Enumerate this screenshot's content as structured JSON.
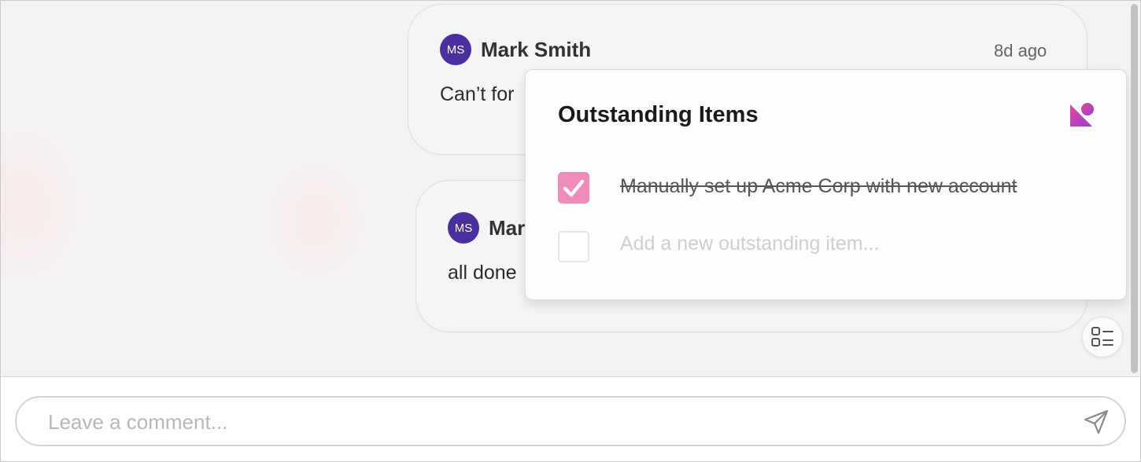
{
  "comments": [
    {
      "initials": "MS",
      "author": "Mark Smith",
      "time": "8d ago",
      "text": "Can’t for"
    },
    {
      "initials": "MS",
      "author": "Mar",
      "text": "all done"
    }
  ],
  "outstanding": {
    "title": "Outstanding Items",
    "items": [
      {
        "label": "Manually set up Acme Corp with new account",
        "checked": true
      }
    ],
    "new_item_placeholder": "Add a new outstanding item..."
  },
  "composer": {
    "placeholder": "Leave a comment..."
  },
  "icons": {
    "brand": "brand-logo-icon",
    "check": "checkmark-icon",
    "checklist": "checklist-icon",
    "send": "send-icon"
  },
  "colors": {
    "avatar": "#4a2f9f",
    "checkbox_checked": "#f08cb9",
    "brand_gradient_start": "#e0479e",
    "brand_gradient_end": "#9b3fd0"
  }
}
